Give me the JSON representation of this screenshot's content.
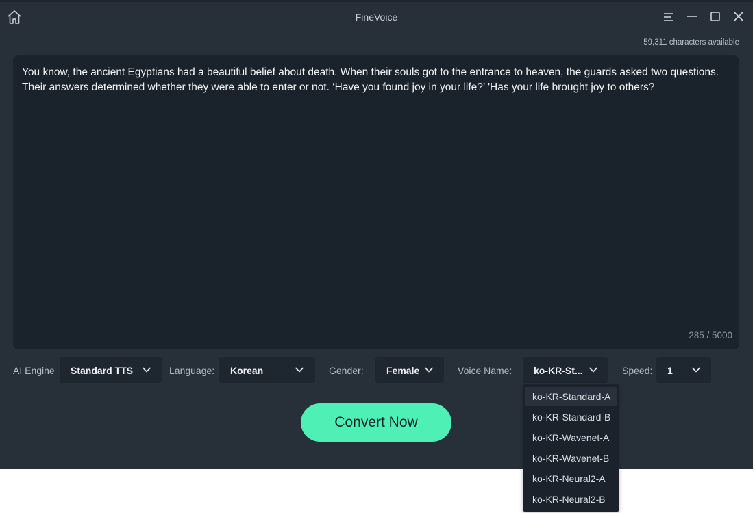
{
  "window": {
    "title": "FineVoice"
  },
  "icons": {
    "home": "home-icon",
    "menu": "menu-icon",
    "minimize": "minimize-icon",
    "maximize": "maximize-icon",
    "close": "close-icon",
    "chevron": "chevron-down-icon"
  },
  "quota": {
    "text": "59,311 characters available"
  },
  "editor": {
    "text": "You know, the ancient Egyptians had a beautiful belief about death. When their souls got to the entrance to heaven, the guards asked two questions. Their answers determined whether they were able to enter or not. ‘Have you found joy in your life?’ 'Has your life brought joy to others?",
    "count": "285 / 5000"
  },
  "controls": {
    "engine": {
      "label": "AI Engine",
      "value": "Standard TTS"
    },
    "language": {
      "label": "Language:",
      "value": "Korean"
    },
    "gender": {
      "label": "Gender:",
      "value": "Female"
    },
    "voice": {
      "label": "Voice Name:",
      "value": "ko-KR-St..."
    },
    "speed": {
      "label": "Speed:",
      "value": "1"
    }
  },
  "convert": {
    "label": "Convert Now"
  },
  "voice_dropdown": {
    "options": [
      "ko-KR-Standard-A",
      "ko-KR-Standard-B",
      "ko-KR-Wavenet-A",
      "ko-KR-Wavenet-B",
      "ko-KR-Neural2-A",
      "ko-KR-Neural2-B"
    ],
    "highlighted": "ko-KR-Standard-A"
  },
  "colors": {
    "background": "#273039",
    "editor": "#1a222c",
    "accent": "#4ef0b6"
  }
}
